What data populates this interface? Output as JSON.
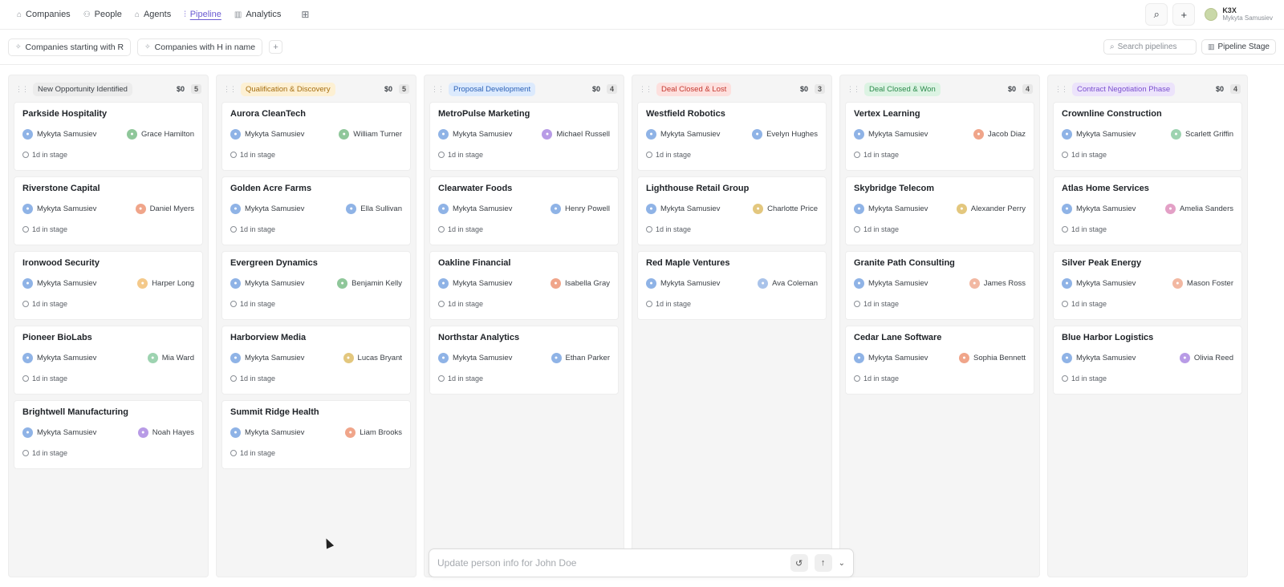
{
  "nav": {
    "items": [
      {
        "label": "Companies",
        "icon": "building-icon",
        "glyph": "⌂",
        "active": false
      },
      {
        "label": "People",
        "icon": "people-icon",
        "glyph": "⚇",
        "active": false
      },
      {
        "label": "Agents",
        "icon": "agent-icon",
        "glyph": "⌂",
        "active": false
      },
      {
        "label": "Pipeline",
        "icon": "pipeline-icon",
        "glyph": "⫶",
        "active": true
      },
      {
        "label": "Analytics",
        "icon": "bar-chart-icon",
        "glyph": "▥",
        "active": false
      }
    ],
    "workspace_name": "K3X",
    "workspace_user": "Mykyta Samusiev"
  },
  "filters": {
    "chips": [
      "Companies starting with R",
      "Companies with H in name"
    ],
    "search_placeholder": "Search pipelines",
    "stage_button": "Pipeline Stage"
  },
  "columns": [
    {
      "title": "New Opportunity Identified",
      "amount": "$0",
      "count": "5",
      "pill_bg": "#ececec",
      "pill_fg": "#3a3f45",
      "cards": [
        {
          "title": "Parkside Hospitality",
          "owner": "Mykyta Samusiev",
          "contact": "Grace Hamilton",
          "contact_color": "#8fc79a",
          "time": "1d in stage"
        },
        {
          "title": "Riverstone Capital",
          "owner": "Mykyta Samusiev",
          "contact": "Daniel Myers",
          "contact_color": "#f0a58a",
          "time": "1d in stage"
        },
        {
          "title": "Ironwood Security",
          "owner": "Mykyta Samusiev",
          "contact": "Harper Long",
          "contact_color": "#f4c98a",
          "time": "1d in stage"
        },
        {
          "title": "Pioneer BioLabs",
          "owner": "Mykyta Samusiev",
          "contact": "Mia Ward",
          "contact_color": "#9dd3b0",
          "time": "1d in stage"
        },
        {
          "title": "Brightwell Manufacturing",
          "owner": "Mykyta Samusiev",
          "contact": "Noah Hayes",
          "contact_color": "#b89be6",
          "time": "1d in stage"
        }
      ]
    },
    {
      "title": "Qualification & Discovery",
      "amount": "$0",
      "count": "5",
      "pill_bg": "#fdf0d3",
      "pill_fg": "#a66f12",
      "cards": [
        {
          "title": "Aurora CleanTech",
          "owner": "Mykyta Samusiev",
          "contact": "William Turner",
          "contact_color": "#8fc79a",
          "time": "1d in stage"
        },
        {
          "title": "Golden Acre Farms",
          "owner": "Mykyta Samusiev",
          "contact": "Ella Sullivan",
          "contact_color": "#8fb3e6",
          "time": "1d in stage"
        },
        {
          "title": "Evergreen Dynamics",
          "owner": "Mykyta Samusiev",
          "contact": "Benjamin Kelly",
          "contact_color": "#8fc79a",
          "time": "1d in stage"
        },
        {
          "title": "Harborview Media",
          "owner": "Mykyta Samusiev",
          "contact": "Lucas Bryant",
          "contact_color": "#e3c77e",
          "time": "1d in stage"
        },
        {
          "title": "Summit Ridge Health",
          "owner": "Mykyta Samusiev",
          "contact": "Liam Brooks",
          "contact_color": "#f0a58a",
          "time": "1d in stage"
        }
      ]
    },
    {
      "title": "Proposal Development",
      "amount": "$0",
      "count": "4",
      "pill_bg": "#dceafd",
      "pill_fg": "#2e63b8",
      "cards": [
        {
          "title": "MetroPulse Marketing",
          "owner": "Mykyta Samusiev",
          "contact": "Michael Russell",
          "contact_color": "#b89be6",
          "time": "1d in stage"
        },
        {
          "title": "Clearwater Foods",
          "owner": "Mykyta Samusiev",
          "contact": "Henry Powell",
          "contact_color": "#8fb3e6",
          "time": "1d in stage"
        },
        {
          "title": "Oakline Financial",
          "owner": "Mykyta Samusiev",
          "contact": "Isabella Gray",
          "contact_color": "#f0a58a",
          "time": "1d in stage"
        },
        {
          "title": "Northstar Analytics",
          "owner": "Mykyta Samusiev",
          "contact": "Ethan Parker",
          "contact_color": "#8fb3e6",
          "time": "1d in stage"
        }
      ]
    },
    {
      "title": "Deal Closed & Lost",
      "amount": "$0",
      "count": "3",
      "pill_bg": "#fde0de",
      "pill_fg": "#c5382f",
      "cards": [
        {
          "title": "Westfield Robotics",
          "owner": "Mykyta Samusiev",
          "contact": "Evelyn Hughes",
          "contact_color": "#8fb3e6",
          "time": "1d in stage"
        },
        {
          "title": "Lighthouse Retail Group",
          "owner": "Mykyta Samusiev",
          "contact": "Charlotte Price",
          "contact_color": "#e3c77e",
          "time": "1d in stage"
        },
        {
          "title": "Red Maple Ventures",
          "owner": "Mykyta Samusiev",
          "contact": "Ava Coleman",
          "contact_color": "#a9c3ea",
          "time": "1d in stage"
        }
      ]
    },
    {
      "title": "Deal Closed & Won",
      "amount": "$0",
      "count": "4",
      "pill_bg": "#dcf3e3",
      "pill_fg": "#2b8a4b",
      "cards": [
        {
          "title": "Vertex Learning",
          "owner": "Mykyta Samusiev",
          "contact": "Jacob Diaz",
          "contact_color": "#f0a58a",
          "time": "1d in stage"
        },
        {
          "title": "Skybridge Telecom",
          "owner": "Mykyta Samusiev",
          "contact": "Alexander Perry",
          "contact_color": "#e3c77e",
          "time": "1d in stage"
        },
        {
          "title": "Granite Path Consulting",
          "owner": "Mykyta Samusiev",
          "contact": "James Ross",
          "contact_color": "#f2b8a2",
          "time": "1d in stage"
        },
        {
          "title": "Cedar Lane Software",
          "owner": "Mykyta Samusiev",
          "contact": "Sophia Bennett",
          "contact_color": "#f0a58a",
          "time": "1d in stage"
        }
      ]
    },
    {
      "title": "Contract Negotiation Phase",
      "amount": "$0",
      "count": "4",
      "pill_bg": "#ece3fb",
      "pill_fg": "#7a4fcf",
      "cards": [
        {
          "title": "Crownline Construction",
          "owner": "Mykyta Samusiev",
          "contact": "Scarlett Griffin",
          "contact_color": "#9dd3b0",
          "time": "1d in stage"
        },
        {
          "title": "Atlas Home Services",
          "owner": "Mykyta Samusiev",
          "contact": "Amelia Sanders",
          "contact_color": "#e3a0c6",
          "time": "1d in stage"
        },
        {
          "title": "Silver Peak Energy",
          "owner": "Mykyta Samusiev",
          "contact": "Mason Foster",
          "contact_color": "#f2b8a2",
          "time": "1d in stage"
        },
        {
          "title": "Blue Harbor Logistics",
          "owner": "Mykyta Samusiev",
          "contact": "Olivia Reed",
          "contact_color": "#b89be6",
          "time": "1d in stage"
        }
      ]
    }
  ],
  "owner_color": "#8fb3e6",
  "chat": {
    "placeholder": "Update person info for John Doe"
  }
}
